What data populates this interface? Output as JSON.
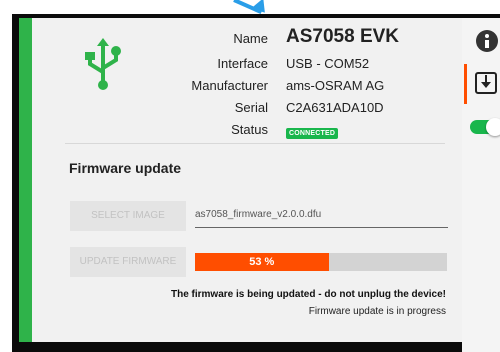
{
  "device": {
    "name_label": "Name",
    "name_value": "AS7058 EVK",
    "interface_label": "Interface",
    "interface_value": "USB - COM52",
    "manufacturer_label": "Manufacturer",
    "manufacturer_value": "ams-OSRAM AG",
    "serial_label": "Serial",
    "serial_value": "C2A631ADA10D",
    "status_label": "Status",
    "status_value": "CONNECTED"
  },
  "firmware": {
    "title": "Firmware update",
    "select_image_label": "SELECT IMAGE",
    "file_name": "as7058_firmware_v2.0.0.dfu",
    "update_label": "UPDATE FIRMWARE",
    "progress_percent": 53,
    "progress_text": "53 %",
    "warning_message": "The firmware is being updated - do not unplug the device!",
    "status_message": "Firmware update is in progress"
  },
  "sidebar": {
    "icons": [
      "info-icon",
      "download-icon",
      "toggle-switch"
    ],
    "toggle_on": true
  },
  "colors": {
    "accent_green": "#2fb34a",
    "status_green": "#19b64c",
    "progress_orange": "#ff4e00",
    "pointer_blue": "#2a9ee8"
  }
}
